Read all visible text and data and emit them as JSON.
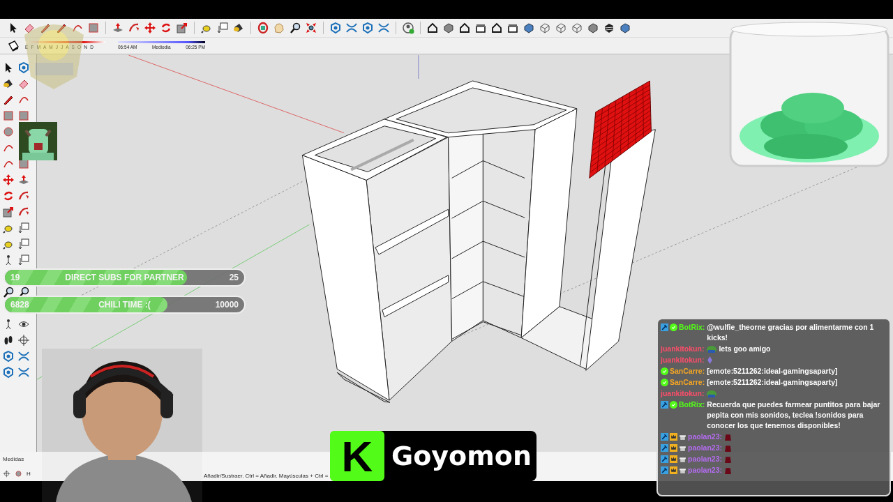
{
  "toolbar": {
    "month_scale": "E F M A M J J A S O N D",
    "time_start": "06:54 AM",
    "time_mid": "Mediodía",
    "time_end": "06:25 PM"
  },
  "goals": [
    {
      "current": "19",
      "label": "DIRECT SUBS FOR PARTNER",
      "target": "25",
      "level": 0.76
    },
    {
      "current": "6828",
      "label": "CHILI TIME :(",
      "target": "10000",
      "level": 0.68
    }
  ],
  "chat": {
    "messages": [
      {
        "kind": "bot",
        "user": "BotRix:",
        "color": "#53fc18",
        "text": "@wulfie_theorne gracias por alimentarme con 1 kicks!"
      },
      {
        "kind": "frog",
        "user": "juankitokun:",
        "color": "#ff4d6a",
        "text": "lets goo amigo"
      },
      {
        "kind": "gem",
        "user": "juankitokun:",
        "color": "#ff4d6a"
      },
      {
        "kind": "verified",
        "user": "SanCarre:",
        "color": "#f5a623",
        "text": "[emote:5211262:ideal-gamingsaparty]"
      },
      {
        "kind": "verified",
        "user": "SanCarre:",
        "color": "#f5a623",
        "text": "[emote:5211262:ideal-gamingsaparty]"
      },
      {
        "kind": "frog",
        "user": "juankitokun:",
        "color": "#ff4d6a"
      },
      {
        "kind": "bot",
        "user": "BotRix:",
        "color": "#53fc18",
        "text": "Recuerda que puedes farmear puntitos para bajar pepita con mis sonidos, teclea !sonidos para conocer los que tenemos disponibles!"
      },
      {
        "kind": "subscriber",
        "user": "paolan23:",
        "color": "#b46cf0"
      },
      {
        "kind": "subscriber",
        "user": "paolan23:",
        "color": "#b46cf0"
      },
      {
        "kind": "subscriber",
        "user": "paolan23:",
        "color": "#b46cf0"
      },
      {
        "kind": "subscriber",
        "user": "paolan23:",
        "color": "#b46cf0"
      }
    ]
  },
  "streamer": {
    "logo": "K",
    "name": "Goyomon"
  },
  "status_bar": {
    "label": "Medidas",
    "hint_start": "H",
    "hint": "Añadir/Sustraer. Ctrl = Añadir. Mayúsculas + Ctrl ="
  }
}
